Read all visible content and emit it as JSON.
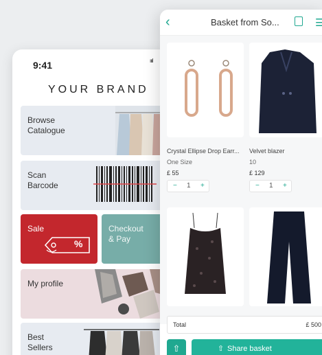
{
  "left_app": {
    "status": {
      "time": "9:41",
      "signal": "ıııl"
    },
    "brand": "YOUR BRAND",
    "tiles": [
      {
        "label": "Browse\nCatalogue"
      },
      {
        "label": "Scan\nBarcode"
      },
      {
        "label": "Sale",
        "badge": "%"
      },
      {
        "label": "Checkout\n& Pay"
      },
      {
        "label": "My profile"
      },
      {
        "label": "Best\nSellers"
      }
    ]
  },
  "basket": {
    "title": "Basket from So...",
    "back_icon": "chevron-left-icon",
    "trash_icon": "trash-icon",
    "menu_icon": "menu-icon",
    "products": [
      {
        "name": "Crystal Ellipse Drop Earr...",
        "size": "One Size",
        "price": "£ 55",
        "qty": "1"
      },
      {
        "name": "Velvet blazer",
        "size": "10",
        "price": "£ 129",
        "qty": "1"
      }
    ],
    "stepper": {
      "minus": "−",
      "plus": "+"
    },
    "total_label": "Total",
    "total_value": "£ 500",
    "share_label": "Share basket",
    "colors": {
      "accent": "#22b39a",
      "sale": "#c3272d",
      "checkout": "#77ada8"
    }
  }
}
